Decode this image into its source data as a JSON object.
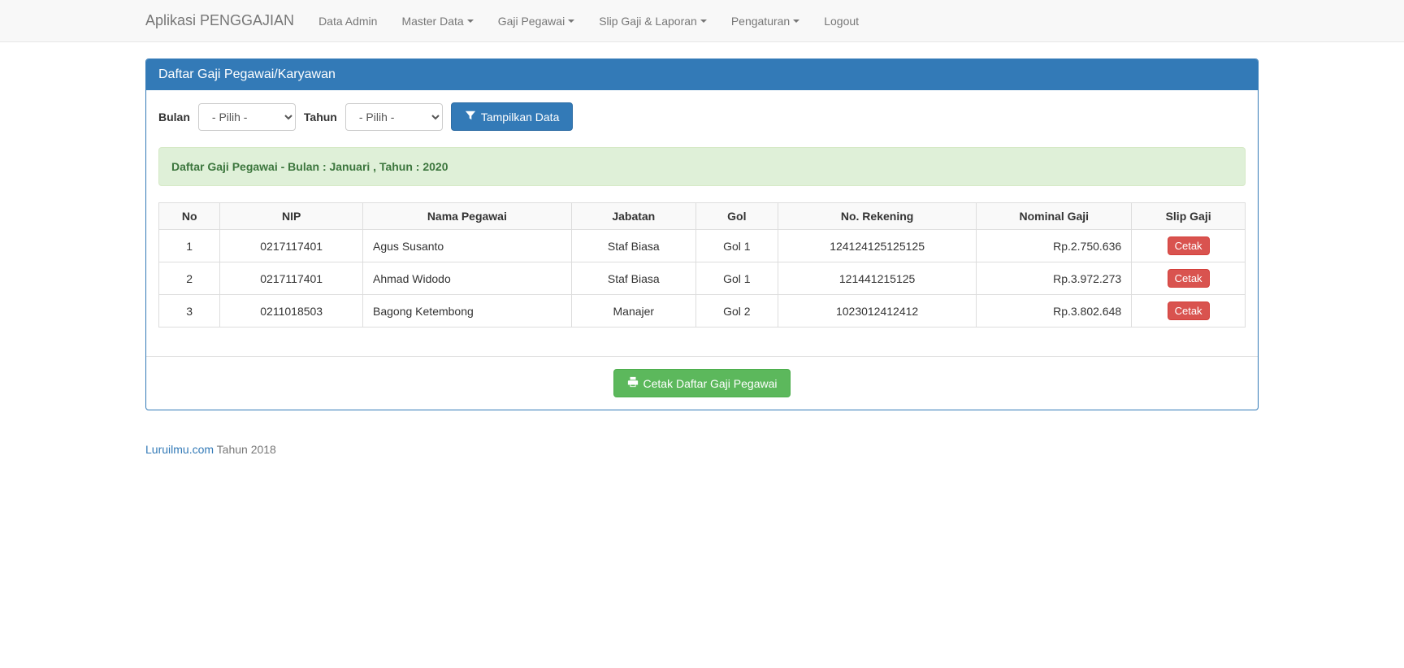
{
  "navbar": {
    "brand": "Aplikasi PENGGAJIAN",
    "items": [
      {
        "label": "Data Admin",
        "dropdown": false
      },
      {
        "label": "Master Data",
        "dropdown": true
      },
      {
        "label": "Gaji Pegawai",
        "dropdown": true
      },
      {
        "label": "Slip Gaji & Laporan",
        "dropdown": true
      },
      {
        "label": "Pengaturan",
        "dropdown": true
      },
      {
        "label": "Logout",
        "dropdown": false
      }
    ]
  },
  "panel": {
    "title": "Daftar Gaji Pegawai/Karyawan"
  },
  "filter": {
    "bulan_label": "Bulan",
    "bulan_value": "- Pilih -",
    "tahun_label": "Tahun",
    "tahun_value": "- Pilih -",
    "tampilkan_label": "Tampilkan Data"
  },
  "alert": {
    "text": "Daftar Gaji Pegawai - Bulan : Januari , Tahun : 2020"
  },
  "table": {
    "headers": [
      "No",
      "NIP",
      "Nama Pegawai",
      "Jabatan",
      "Gol",
      "No. Rekening",
      "Nominal Gaji",
      "Slip Gaji"
    ],
    "cetak_label": "Cetak",
    "rows": [
      {
        "no": "1",
        "nip": "0217117401",
        "nama": "Agus Susanto",
        "jabatan": "Staf Biasa",
        "gol": "Gol 1",
        "rekening": "124124125125125",
        "nominal": "Rp.2.750.636"
      },
      {
        "no": "2",
        "nip": "0217117401",
        "nama": "Ahmad Widodo",
        "jabatan": "Staf Biasa",
        "gol": "Gol 1",
        "rekening": "121441215125",
        "nominal": "Rp.3.972.273"
      },
      {
        "no": "3",
        "nip": "0211018503",
        "nama": "Bagong Ketembong",
        "jabatan": "Manajer",
        "gol": "Gol 2",
        "rekening": "1023012412412",
        "nominal": "Rp.3.802.648"
      }
    ]
  },
  "footer_button": {
    "label": "Cetak Daftar Gaji Pegawai"
  },
  "page_footer": {
    "link": "Luruilmu.com",
    "text": " Tahun 2018"
  }
}
